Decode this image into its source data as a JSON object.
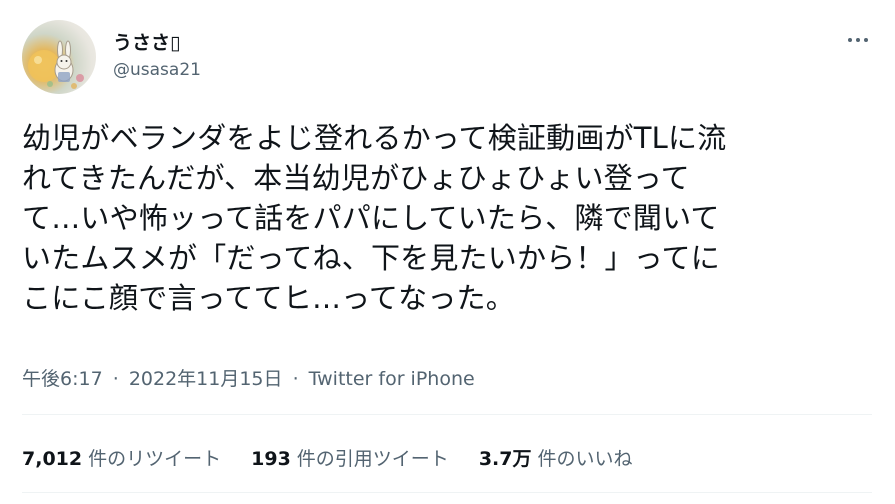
{
  "user": {
    "display_name": "うささ▯",
    "handle": "@usasa21"
  },
  "tweet": {
    "lines": [
      "幼児がベランダをよじ登れるかって検証動画がTLに流",
      "れてきたんだが、本当幼児がひょひょひょい登って",
      "て…いや怖ッって話をパパにしていたら、隣で聞いて",
      "いたムスメが「だってね、下を見たいから！」ってに",
      "こにこ顔で言っててヒ…ってなった。"
    ],
    "time": "午後6:17",
    "separator": "·",
    "date": "2022年11月15日",
    "client": "Twitter for iPhone"
  },
  "stats": {
    "retweets_count": "7,012",
    "retweets_label": "件のリツイート",
    "quotes_count": "193",
    "quotes_label": "件の引用ツイート",
    "likes_count": "3.7万",
    "likes_label": "件のいいね"
  },
  "icons": {
    "more": "more-horizontal-icon"
  },
  "colors": {
    "text_primary": "#0f1419",
    "text_secondary": "#536471",
    "divider": "#eff3f4"
  }
}
